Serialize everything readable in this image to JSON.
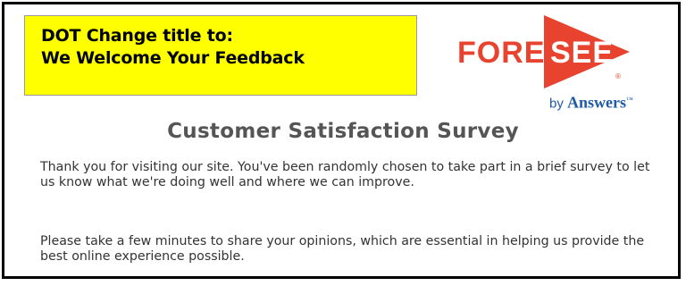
{
  "annotation": {
    "line1": "DOT Change title to:",
    "line2": "We Welcome Your Feedback",
    "background": "#ffff00"
  },
  "logo": {
    "part1": "FORE",
    "part2": "SEE",
    "registered": "®",
    "by": "by ",
    "company": "Answers",
    "trademark": "™",
    "brand_color": "#e8432e",
    "tagline_color": "#1f5aa6"
  },
  "survey": {
    "title": "Customer Satisfaction Survey",
    "intro": "Thank you for visiting our site. You've been randomly chosen to take part in a brief survey to let us know what we're doing well and where we can improve.",
    "request": "Please take a few minutes to share your opinions, which are essential in helping us provide the best online experience possible."
  }
}
